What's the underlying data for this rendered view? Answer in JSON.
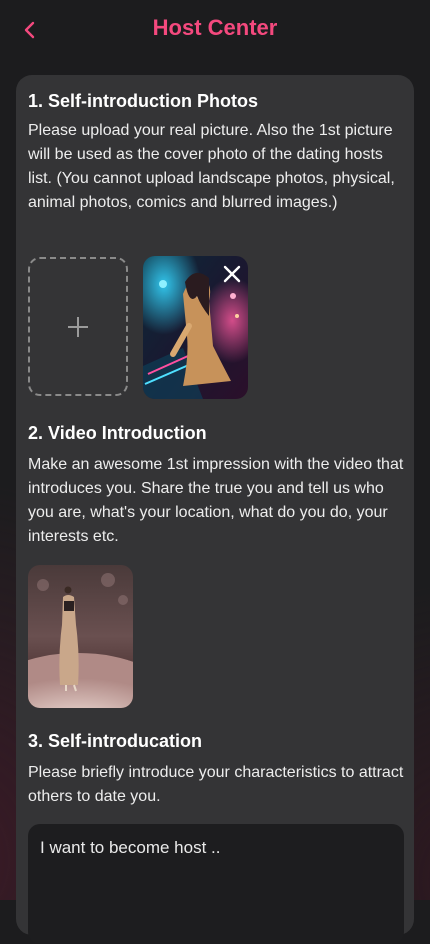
{
  "header": {
    "title": "Host Center",
    "back_icon": "chevron-left-icon",
    "accent_color": "#f4497e"
  },
  "sections": [
    {
      "title": "1. Self-introduction Photos",
      "description": "Please upload your real picture. Also the 1st picture will be used as the cover photo of the dating hosts list. (You cannot upload landscape photos, physical, animal photos, comics and blurred images.)"
    },
    {
      "title": "2. Video Introduction",
      "description": "Make an awesome 1st impression with the video that introduces you. Share the true you and tell us who you are, what's your location, what do you do, your interests etc."
    },
    {
      "title": "3. Self-introducation",
      "description": "Please briefly introduce your characteristics to attract others to date you."
    }
  ],
  "photos": {
    "add_icon": "plus-icon",
    "remove_icon": "close-icon"
  },
  "intro_input": {
    "value": "I want to become host .."
  }
}
